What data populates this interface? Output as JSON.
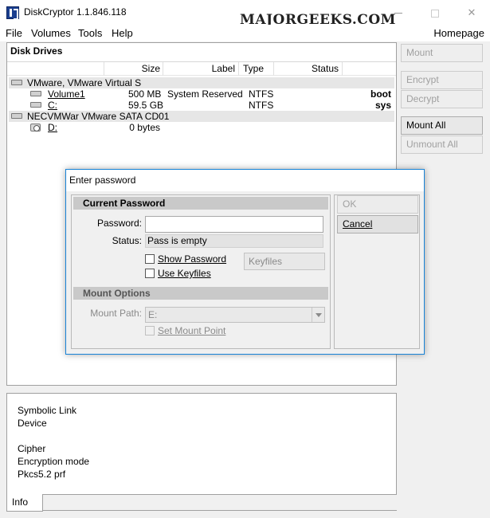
{
  "window": {
    "title": "DiskCryptor 1.1.846.118",
    "watermark": "MAJORGEEKS.COM"
  },
  "menu": {
    "items": [
      "File",
      "Volumes",
      "Tools",
      "Help"
    ],
    "homepage": "Homepage"
  },
  "disk_panel": {
    "title": "Disk Drives",
    "columns": [
      "Size",
      "Label",
      "Type",
      "Status"
    ],
    "groups": [
      {
        "name": "VMware, VMware Virtual S",
        "volumes": [
          {
            "name": "Volume1",
            "size": "500 MB",
            "label": "System Reserved",
            "type": "NTFS",
            "status": "boot"
          },
          {
            "name": "C:",
            "size": "59.5 GB",
            "label": "",
            "type": "NTFS",
            "status": "sys"
          }
        ]
      },
      {
        "name": "NECVMWar VMware SATA CD01",
        "volumes": [
          {
            "name": "D:",
            "size": "0 bytes",
            "label": "",
            "type": "",
            "status": ""
          }
        ]
      }
    ]
  },
  "side_buttons": {
    "mount": "Mount",
    "encrypt": "Encrypt",
    "decrypt": "Decrypt",
    "mount_all": "Mount All",
    "unmount_all": "Unmount All"
  },
  "info_panel": {
    "lines": [
      "Symbolic Link",
      "Device",
      "Cipher",
      "Encryption mode",
      "Pkcs5.2 prf"
    ],
    "tab": "Info"
  },
  "dialog": {
    "title": "Enter password",
    "current_password_section": "Current Password",
    "password_label": "Password:",
    "password_value": "",
    "status_label": "Status:",
    "status_value": "Pass is empty",
    "show_password": "Show Password",
    "use_keyfiles": "Use Keyfiles",
    "keyfiles_button": "Keyfiles",
    "mount_options_section": "Mount Options",
    "mount_path_label": "Mount Path:",
    "mount_path_value": "E:",
    "set_mount_point": "Set Mount Point",
    "ok_button": "OK",
    "cancel_button": "Cancel"
  }
}
